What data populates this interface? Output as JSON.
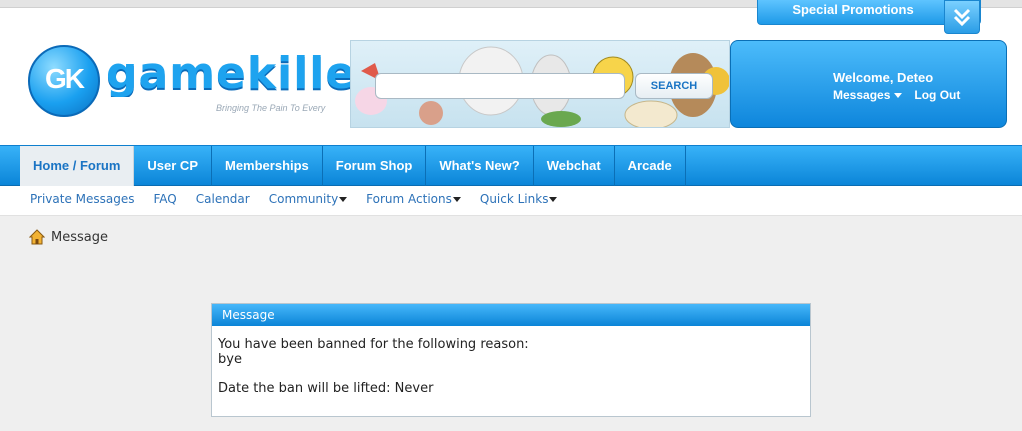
{
  "promo": {
    "label": "Special Promotions"
  },
  "logo": {
    "mark": "GK",
    "wordmark": "gamekille",
    "tagline": "Bringing The Pain To Every"
  },
  "search": {
    "button_label": "SEARCH",
    "placeholder": ""
  },
  "user": {
    "welcome": "Welcome, Deteo",
    "messages_label": "Messages",
    "logout_label": "Log Out"
  },
  "nav": {
    "tabs": [
      {
        "label": "Home / Forum"
      },
      {
        "label": "User CP"
      },
      {
        "label": "Memberships"
      },
      {
        "label": "Forum Shop"
      },
      {
        "label": "What's New?"
      },
      {
        "label": "Webchat"
      },
      {
        "label": "Arcade"
      }
    ]
  },
  "subnav": {
    "links": [
      {
        "label": "Private Messages"
      },
      {
        "label": "FAQ"
      },
      {
        "label": "Calendar"
      },
      {
        "label": "Community"
      },
      {
        "label": "Forum Actions"
      },
      {
        "label": "Quick Links"
      }
    ]
  },
  "breadcrumb": {
    "label": "Message"
  },
  "message": {
    "title": "Message",
    "line1": "You have been banned for the following reason:",
    "reason": "bye",
    "lifted": "Date the ban will be lifted: Never"
  },
  "colors": {
    "accent": "#0e86dc",
    "link": "#2d72b8",
    "background": "#efefef"
  },
  "icons": {
    "home": "home-icon",
    "promo": "double-chevron-down-icon"
  }
}
